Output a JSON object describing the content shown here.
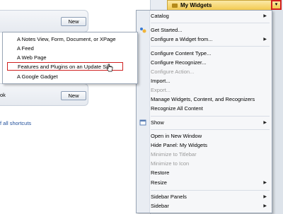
{
  "background": {
    "new_button_1": "New",
    "new_button_2": "New",
    "partial_label": "ok",
    "all_shortcuts_link": "f all shortcuts"
  },
  "widget": {
    "title": "My Widgets",
    "dropdown_glyph": "▾"
  },
  "menu": {
    "items": [
      {
        "label": "Catalog",
        "submenu": true,
        "enabled": true
      },
      {
        "label": "Get Started...",
        "enabled": true,
        "icon": "get-started-icon"
      },
      {
        "label": "Configure a Widget from...",
        "submenu": true,
        "enabled": true
      },
      {
        "label": "Configure Content Type...",
        "enabled": true
      },
      {
        "label": "Configure Recognizer...",
        "enabled": true
      },
      {
        "label": "Configure Action...",
        "enabled": false
      },
      {
        "label": "Import...",
        "enabled": true
      },
      {
        "label": "Export...",
        "enabled": false
      },
      {
        "label": "Manage Widgets, Content, and Recognizers",
        "enabled": true
      },
      {
        "label": "Recognize All Content",
        "enabled": true
      },
      {
        "label": "Show",
        "submenu": true,
        "enabled": true,
        "icon": "show-icon"
      },
      {
        "label": "Open in New Window",
        "enabled": true
      },
      {
        "label": "Hide Panel: My Widgets",
        "enabled": true
      },
      {
        "label": "Minimize to Titlebar",
        "enabled": false
      },
      {
        "label": "Minimize to Icon",
        "enabled": false
      },
      {
        "label": "Restore",
        "enabled": true
      },
      {
        "label": "Resize",
        "submenu": true,
        "enabled": true
      },
      {
        "label": "Sidebar Panels",
        "submenu": true,
        "enabled": true
      },
      {
        "label": "Sidebar",
        "submenu": true,
        "enabled": true
      }
    ]
  },
  "submenu": {
    "items": [
      {
        "label": "A Notes View, Form, Document, or XPage"
      },
      {
        "label": "A Feed"
      },
      {
        "label": "A Web Page"
      },
      {
        "label": "Features and Plugins on an Update Site",
        "highlighted": true
      },
      {
        "label": "A Google Gadget"
      }
    ]
  },
  "colors": {
    "highlight_border": "#d02020",
    "widget_header": "#f2c84a",
    "link": "#1f4e9a"
  }
}
